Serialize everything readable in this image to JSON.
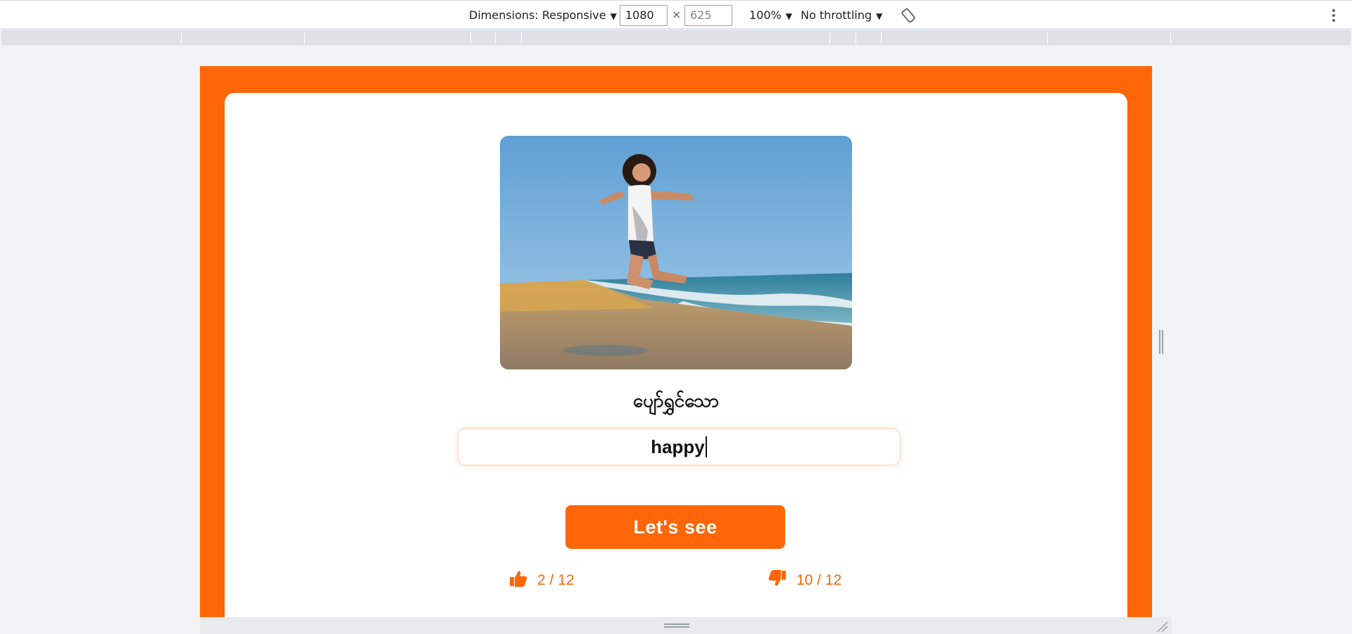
{
  "devtools": {
    "dimensions_label": "Dimensions: Responsive",
    "width_value": "1080",
    "height_placeholder": "625",
    "times_symbol": "×",
    "zoom_label": "100%",
    "throttling_label": "No throttling",
    "caret": "▼"
  },
  "quiz": {
    "photo_alt": "Woman jumping on a beach",
    "word": "ပျော်ရွှင်သော",
    "answer_value": "happy",
    "submit_label": "Let's see",
    "correct_score": "2 / 12",
    "wrong_score": "10 / 12"
  },
  "colors": {
    "accent": "#ff6607",
    "toolbar_bg": "#ffffff",
    "ruler_bg": "#dee1e6"
  }
}
